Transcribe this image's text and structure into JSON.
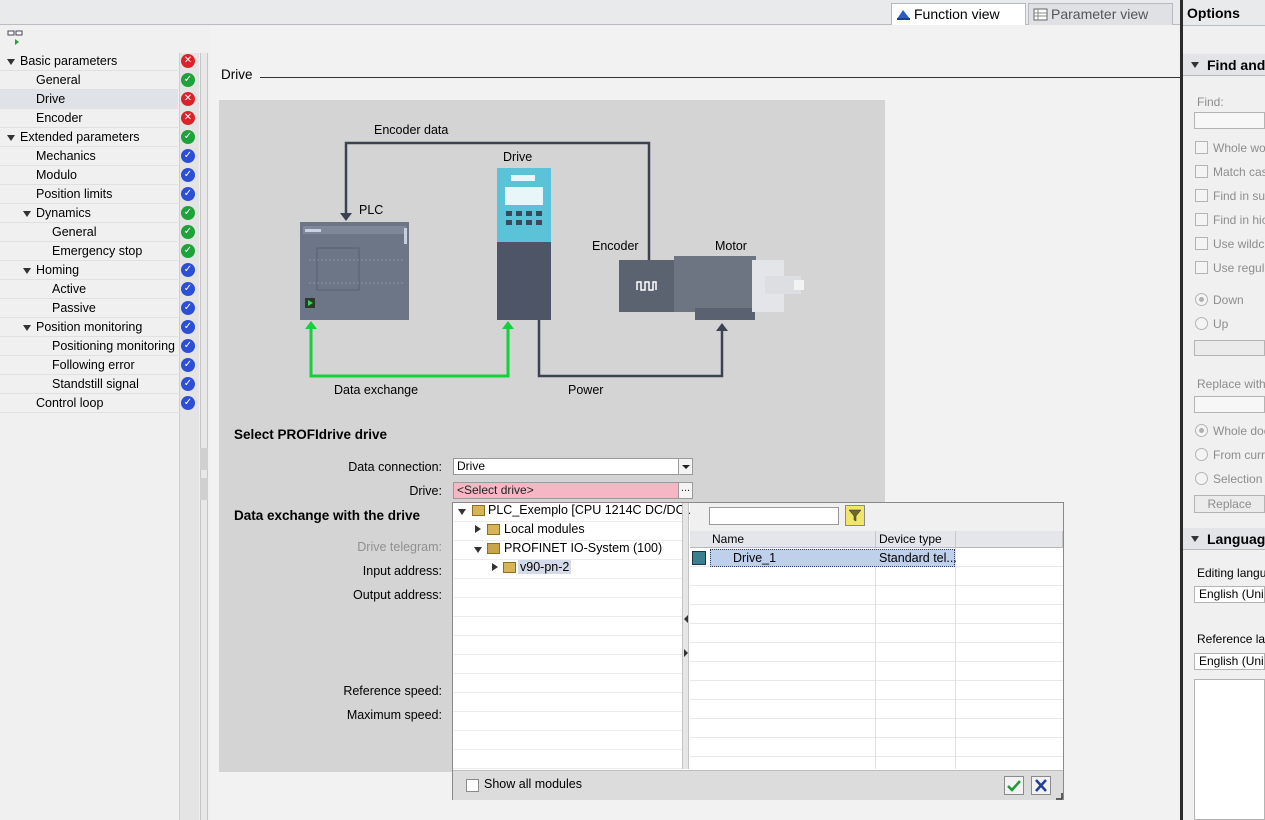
{
  "tabs": {
    "function_view": "Function view",
    "parameter_view": "Parameter view"
  },
  "tree": [
    {
      "label": "Basic parameters",
      "status": "error"
    },
    {
      "label": "General",
      "status": "ok"
    },
    {
      "label": "Drive",
      "status": "error",
      "selected": true
    },
    {
      "label": "Encoder",
      "status": "error"
    },
    {
      "label": "Extended parameters",
      "status": "ok"
    },
    {
      "label": "Mechanics",
      "status": "info"
    },
    {
      "label": "Modulo",
      "status": "info"
    },
    {
      "label": "Position limits",
      "status": "info"
    },
    {
      "label": "Dynamics",
      "status": "ok"
    },
    {
      "label": "General",
      "status": "ok"
    },
    {
      "label": "Emergency stop",
      "status": "ok"
    },
    {
      "label": "Homing",
      "status": "info"
    },
    {
      "label": "Active",
      "status": "info"
    },
    {
      "label": "Passive",
      "status": "info"
    },
    {
      "label": "Position monitoring",
      "status": "info"
    },
    {
      "label": "Positioning monitoring",
      "status": "info"
    },
    {
      "label": "Following error",
      "status": "info"
    },
    {
      "label": "Standstill signal",
      "status": "info"
    },
    {
      "label": "Control loop",
      "status": "info"
    }
  ],
  "main": {
    "section_title": "Drive",
    "diagram": {
      "encoder_data": "Encoder data",
      "drive": "Drive",
      "plc": "PLC",
      "encoder": "Encoder",
      "motor": "Motor",
      "data_exchange": "Data exchange",
      "power": "Power"
    },
    "select_heading": "Select PROFIdrive drive",
    "data_connection_label": "Data connection:",
    "data_connection_value": "Drive",
    "drive_label": "Drive:",
    "drive_value": "<Select drive>",
    "exchange_heading": "Data exchange with the drive",
    "drive_telegram_label": "Drive telegram:",
    "input_address_label": "Input address:",
    "output_address_label": "Output address:",
    "reference_speed_label": "Reference speed:",
    "maximum_speed_label": "Maximum speed:"
  },
  "popup": {
    "tree": {
      "plc": "PLC_Exemplo [CPU 1214C DC/DC...",
      "local_modules": "Local modules",
      "profinet": "PROFINET IO-System (100)",
      "device": "v90-pn-2"
    },
    "search_value": "",
    "columns": {
      "name": "Name",
      "device_type": "Device type"
    },
    "rows": [
      {
        "name": "Drive_1",
        "device_type": "Standard tel..."
      }
    ],
    "show_all_modules": "Show all modules"
  },
  "right": {
    "options": "Options",
    "find_section": "Find and",
    "find_label": "Find:",
    "checks": [
      "Whole wo",
      "Match cas",
      "Find in su",
      "Find in hic",
      "Use wildc",
      "Use regul"
    ],
    "down": "Down",
    "up": "Up",
    "replace_with": "Replace with",
    "whole_doc": "Whole doc",
    "from_curr": "From curr",
    "selection": "Selection",
    "replace_btn": "Replace",
    "language_section": "Language",
    "editing_lang": "Editing langu",
    "editing_value": "English (Uni",
    "reference_lang": "Reference la",
    "reference_value": "English (Uni"
  },
  "colors": {
    "green_line": "#13d13b",
    "wire": "#3b4250",
    "error": "#d8232a",
    "ok": "#1ea23a",
    "info": "#2d4fd6"
  }
}
